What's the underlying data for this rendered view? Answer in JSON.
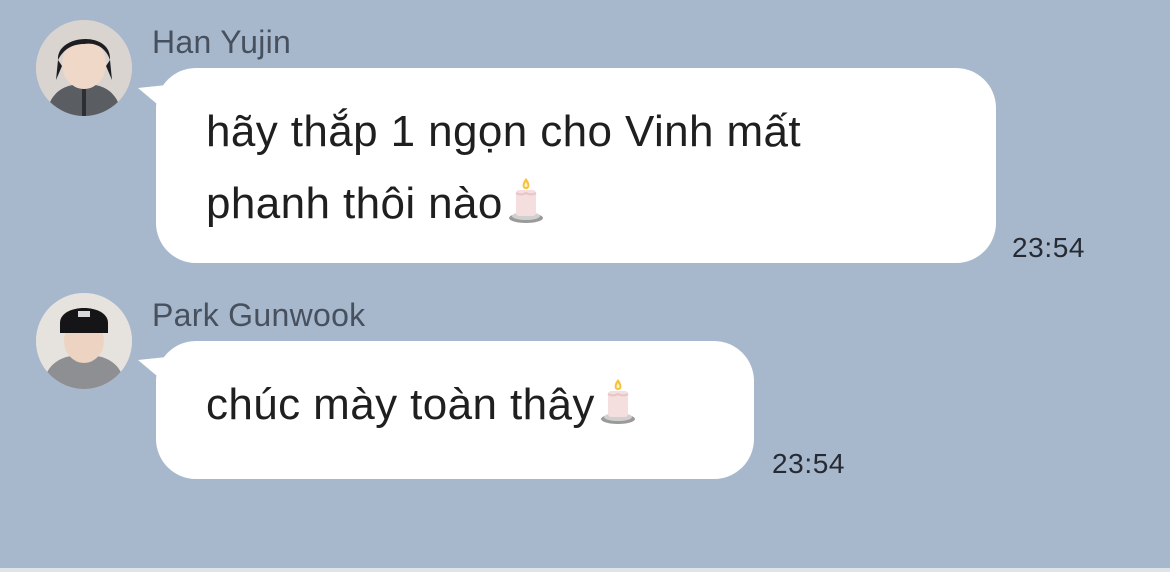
{
  "messages": [
    {
      "sender": "Han Yujin",
      "avatar_icon": "avatar-photo",
      "text": "hãy thắp 1 ngọn cho Vinh mất phanh thôi nào",
      "lines": [
        "hãy thắp 1 ngọn cho Vinh mất",
        "phanh thôi nào"
      ],
      "emoji": "candle-icon",
      "time": "23:54"
    },
    {
      "sender": "Park Gunwook",
      "avatar_icon": "avatar-photo",
      "text": "chúc mày toàn thây",
      "lines": [
        "chúc mày toàn thây"
      ],
      "emoji": "candle-icon",
      "time": "23:54"
    }
  ],
  "colors": {
    "background": "#a8b8cc",
    "bubble": "#ffffff",
    "sender_text": "#46505e",
    "time_text": "#252a33"
  }
}
